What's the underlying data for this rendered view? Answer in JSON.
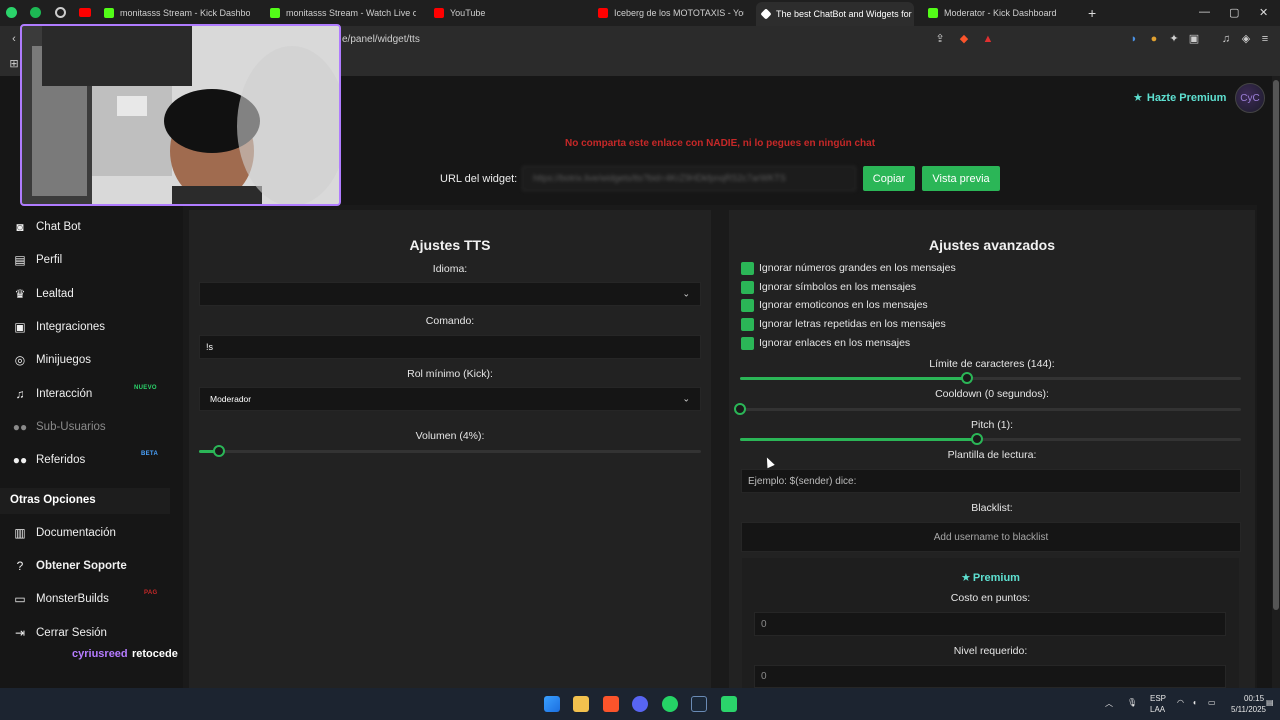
{
  "browser": {
    "tabs": [
      {
        "label": "monitasss Stream - Kick Dashboard",
        "color": "#53fc18"
      },
      {
        "label": "monitasss Stream - Watch Live on Kick",
        "color": "#53fc18"
      },
      {
        "label": "YouTube",
        "color": "#ff0000"
      },
      {
        "label": "Iceberg de los MOTOTAXIS - YouTube",
        "color": "#ff0000"
      },
      {
        "label": "The best ChatBot and Widgets for Kick",
        "color": "#ffffff"
      },
      {
        "label": "Moderator - Kick Dashboard",
        "color": "#53fc18"
      }
    ],
    "new_tab": "+",
    "url": "e/panel/widget/tts",
    "window_controls": {
      "minimize": "—",
      "maximize": "▢",
      "close": "✕"
    }
  },
  "header": {
    "premium_label": "Hazte Premium",
    "avatar_text": "CyC"
  },
  "widget_url": {
    "warning": "No comparta este enlace con NADIE, ni lo pegues en ningún chat",
    "label": "URL del widget:",
    "value": "https://botrix.live/widgets/tts?bid=4KrZ9HDkfpnqRS2c7arWKTS",
    "copy_button": "Copiar",
    "preview_button": "Vista previa"
  },
  "sidebar": {
    "items": [
      {
        "label": "Chat Bot",
        "icon": "robot-icon"
      },
      {
        "label": "Perfil",
        "icon": "id-card-icon"
      },
      {
        "label": "Lealtad",
        "icon": "trophy-icon"
      },
      {
        "label": "Integraciones",
        "icon": "plug-icon"
      },
      {
        "label": "Minijuegos",
        "icon": "gamepad-icon"
      },
      {
        "label": "Interacción",
        "icon": "music-icon",
        "badge": "NUEVO"
      },
      {
        "label": "Sub-Usuarios",
        "icon": "users-icon"
      },
      {
        "label": "Referidos",
        "icon": "users-icon",
        "badge": "BETA"
      }
    ],
    "section_title": "Otras Opciones",
    "other_items": [
      {
        "label": "Documentación",
        "icon": "book-icon"
      },
      {
        "label": "Obtener Soporte",
        "icon": "question-icon"
      },
      {
        "label": "MonsterBuilds",
        "icon": "laptop-icon",
        "badge": "PAG"
      },
      {
        "label": "Cerrar Sesión",
        "icon": "logout-icon"
      }
    ],
    "username": "cyriusreed",
    "status": "retocede"
  },
  "tts_settings": {
    "title": "Ajustes TTS",
    "language_label": "Idioma:",
    "language_value": "",
    "command_label": "Comando:",
    "command_value": "!s",
    "role_label": "Rol mínimo (Kick):",
    "role_value": "Moderador",
    "volume_label": "Volumen (4%):",
    "volume_percent": 4
  },
  "advanced": {
    "title": "Ajustes avanzados",
    "checkboxes": [
      "Ignorar números grandes en los mensajes",
      "Ignorar símbolos en los mensajes",
      "Ignorar emoticonos en los mensajes",
      "Ignorar letras repetidas en los mensajes",
      "Ignorar enlaces en los mensajes"
    ],
    "char_limit_label": "Límite de caracteres (144):",
    "char_limit_fraction": 0.454,
    "cooldown_label": "Cooldown (0 segundos):",
    "cooldown_fraction": 0,
    "pitch_label": "Pitch (1):",
    "pitch_fraction": 0.474,
    "template_label": "Plantilla de lectura:",
    "template_placeholder": "Ejemplo: $(sender) dice:",
    "blacklist_label": "Blacklist:",
    "blacklist_placeholder": "Add username to blacklist",
    "premium_title": "Premium",
    "cost_label": "Costo en puntos:",
    "cost_value": "0",
    "level_label": "Nivel requerido:",
    "level_value": "0"
  },
  "taskbar": {
    "lang_top": "ESP",
    "lang_bottom": "LAA",
    "time": "00:15",
    "date": "5/11/2025"
  },
  "colors": {
    "accent_green": "#2bb657",
    "premium_teal": "#5ee0d1",
    "warning_red": "#c62828",
    "username_purple": "#b57bff"
  }
}
